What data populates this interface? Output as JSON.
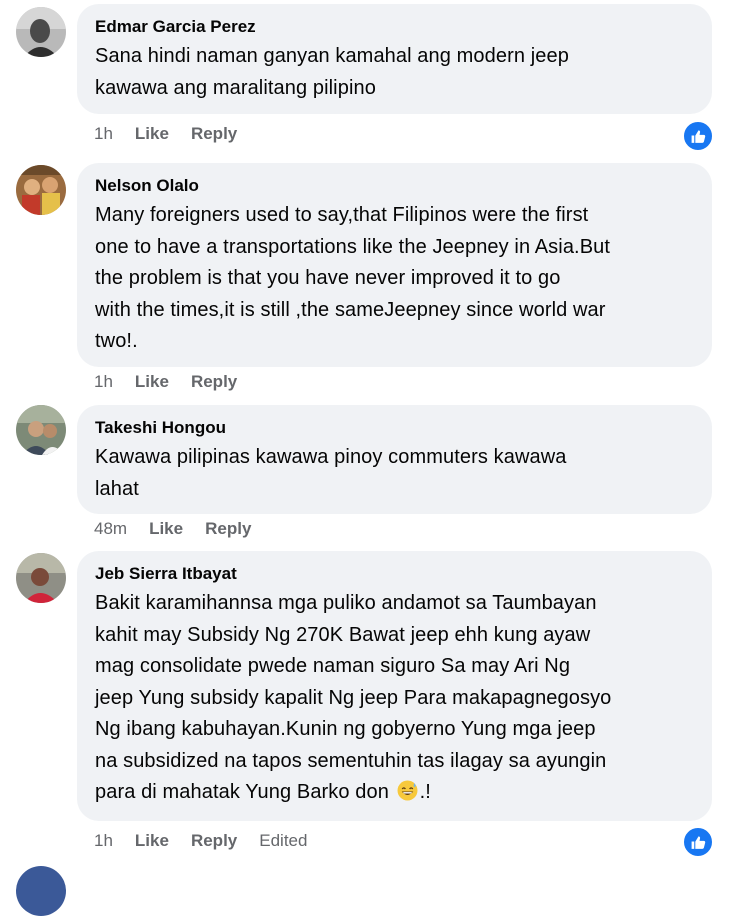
{
  "comments": [
    {
      "author": "Edmar Garcia Perez",
      "lines": [
        "Sana hindi naman ganyan kamahal ang modern jeep",
        "kawawa ang maralitang pilipino"
      ],
      "time": "1h",
      "like_label": "Like",
      "reply_label": "Reply",
      "has_reaction": true
    },
    {
      "author": "Nelson Olalo",
      "lines": [
        "Many foreigners used to say,that Filipinos were the first",
        "one to have a transportations like the Jeepney in Asia.But",
        "the problem is that you have never improved it to go",
        "with the times,it is still ,the sameJeepney since world war",
        "two!."
      ],
      "time": "1h",
      "like_label": "Like",
      "reply_label": "Reply",
      "has_reaction": false
    },
    {
      "author": "Takeshi Hongou",
      "lines": [
        "Kawawa pilipinas kawawa pinoy commuters kawawa",
        "lahat"
      ],
      "time": "48m",
      "like_label": "Like",
      "reply_label": "Reply",
      "has_reaction": false
    },
    {
      "author": "Jeb Sierra Itbayat",
      "lines": [
        "Bakit karamihannsa mga puliko andamot sa Taumbayan",
        "kahit may Subsidy Ng 270K Bawat jeep ehh kung ayaw",
        "mag consolidate pwede naman siguro Sa may Ari Ng",
        "jeep Yung subsidy kapalit Ng jeep Para makapagnegosyo",
        "Ng ibang kabuhayan.Kunin ng gobyerno Yung mga jeep",
        "na subsidized na tapos sementuhin tas ilagay sa ayungin",
        "para di mahatak Yung Barko don"
      ],
      "last_line_suffix": ".!",
      "emoji": "grinning-sweat-emoji",
      "time": "1h",
      "like_label": "Like",
      "reply_label": "Reply",
      "edited_label": "Edited",
      "has_reaction": true
    }
  ],
  "colors": {
    "bubble": "#f0f2f5",
    "meta": "#65676b",
    "like_blue": "#1877f2"
  }
}
